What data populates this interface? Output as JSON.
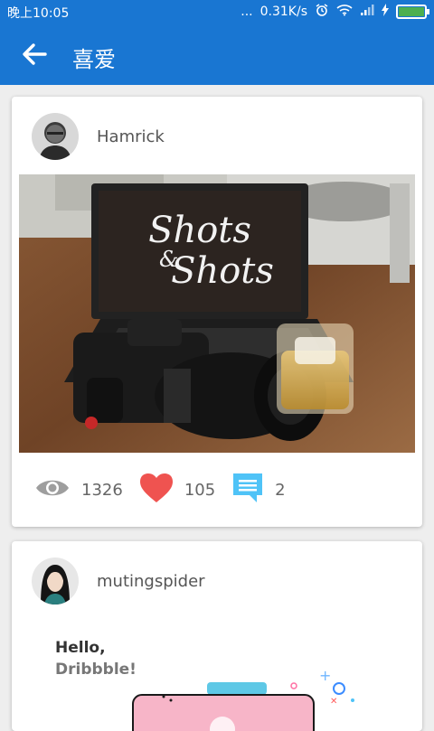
{
  "status_bar": {
    "time": "晚上10:05",
    "dots": "...",
    "net_speed": "0.31K/s",
    "alarm_icon": "alarm-icon",
    "wifi_icon": "wifi-icon",
    "signal_icon": "signal-icon",
    "charging_icon": "charging-icon",
    "battery_icon": "battery-icon"
  },
  "app_bar": {
    "title": "喜爱",
    "back_icon": "arrow-left-icon",
    "color": "#1976d2"
  },
  "posts": [
    {
      "username": "Hamrick",
      "stats": {
        "views": "1326",
        "likes": "105",
        "comments": "2"
      },
      "icons": {
        "views": "eye-icon",
        "likes": "heart-icon",
        "comments": "comment-icon"
      }
    },
    {
      "username": "mutingspider",
      "preview": {
        "line1": "Hello,",
        "line2": "Dribbble!"
      }
    }
  ]
}
